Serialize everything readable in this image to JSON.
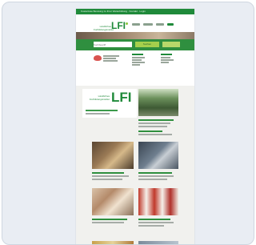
{
  "screenshot": {
    "topbar": {
      "text": "Kostenlose Beratung zu Ihrer Weiterbildung · Kontakt · Login"
    },
    "header": {
      "logo_text": "LFI",
      "logo_tagline": "Ländliches Fortbildungsinstitut",
      "nav_items": [
        "Kurse",
        "Themen",
        "Service",
        "Über uns"
      ]
    },
    "search": {
      "placeholder": "Suchbegriff",
      "button_label": "Suchen"
    },
    "promo": {
      "logo_text": "LFI",
      "tagline": "Ländliches Fortbildungsinstitut"
    },
    "colors": {
      "brand_green": "#1f8a3a",
      "accent_lime": "#a5cf4c",
      "frame_bg": "#e9edf3"
    }
  }
}
